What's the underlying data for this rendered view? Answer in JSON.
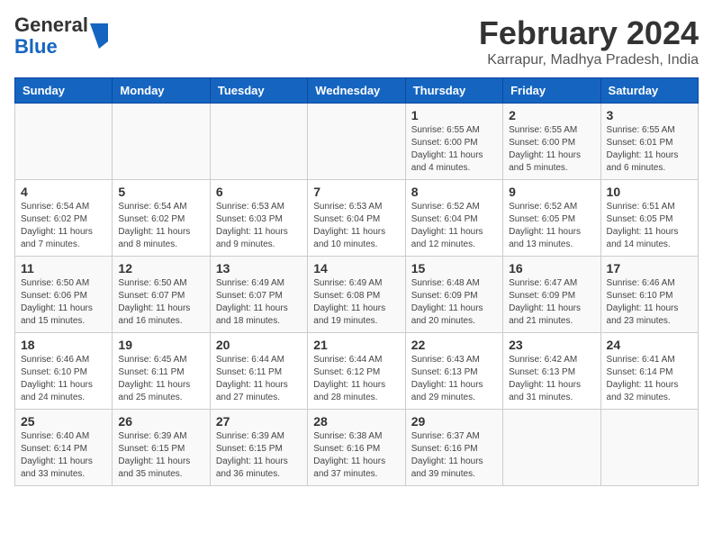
{
  "logo": {
    "general": "General",
    "blue": "Blue"
  },
  "header": {
    "month": "February 2024",
    "location": "Karrapur, Madhya Pradesh, India"
  },
  "days_of_week": [
    "Sunday",
    "Monday",
    "Tuesday",
    "Wednesday",
    "Thursday",
    "Friday",
    "Saturday"
  ],
  "weeks": [
    [
      {
        "day": "",
        "info": ""
      },
      {
        "day": "",
        "info": ""
      },
      {
        "day": "",
        "info": ""
      },
      {
        "day": "",
        "info": ""
      },
      {
        "day": "1",
        "info": "Sunrise: 6:55 AM\nSunset: 6:00 PM\nDaylight: 11 hours and 4 minutes."
      },
      {
        "day": "2",
        "info": "Sunrise: 6:55 AM\nSunset: 6:00 PM\nDaylight: 11 hours and 5 minutes."
      },
      {
        "day": "3",
        "info": "Sunrise: 6:55 AM\nSunset: 6:01 PM\nDaylight: 11 hours and 6 minutes."
      }
    ],
    [
      {
        "day": "4",
        "info": "Sunrise: 6:54 AM\nSunset: 6:02 PM\nDaylight: 11 hours and 7 minutes."
      },
      {
        "day": "5",
        "info": "Sunrise: 6:54 AM\nSunset: 6:02 PM\nDaylight: 11 hours and 8 minutes."
      },
      {
        "day": "6",
        "info": "Sunrise: 6:53 AM\nSunset: 6:03 PM\nDaylight: 11 hours and 9 minutes."
      },
      {
        "day": "7",
        "info": "Sunrise: 6:53 AM\nSunset: 6:04 PM\nDaylight: 11 hours and 10 minutes."
      },
      {
        "day": "8",
        "info": "Sunrise: 6:52 AM\nSunset: 6:04 PM\nDaylight: 11 hours and 12 minutes."
      },
      {
        "day": "9",
        "info": "Sunrise: 6:52 AM\nSunset: 6:05 PM\nDaylight: 11 hours and 13 minutes."
      },
      {
        "day": "10",
        "info": "Sunrise: 6:51 AM\nSunset: 6:05 PM\nDaylight: 11 hours and 14 minutes."
      }
    ],
    [
      {
        "day": "11",
        "info": "Sunrise: 6:50 AM\nSunset: 6:06 PM\nDaylight: 11 hours and 15 minutes."
      },
      {
        "day": "12",
        "info": "Sunrise: 6:50 AM\nSunset: 6:07 PM\nDaylight: 11 hours and 16 minutes."
      },
      {
        "day": "13",
        "info": "Sunrise: 6:49 AM\nSunset: 6:07 PM\nDaylight: 11 hours and 18 minutes."
      },
      {
        "day": "14",
        "info": "Sunrise: 6:49 AM\nSunset: 6:08 PM\nDaylight: 11 hours and 19 minutes."
      },
      {
        "day": "15",
        "info": "Sunrise: 6:48 AM\nSunset: 6:09 PM\nDaylight: 11 hours and 20 minutes."
      },
      {
        "day": "16",
        "info": "Sunrise: 6:47 AM\nSunset: 6:09 PM\nDaylight: 11 hours and 21 minutes."
      },
      {
        "day": "17",
        "info": "Sunrise: 6:46 AM\nSunset: 6:10 PM\nDaylight: 11 hours and 23 minutes."
      }
    ],
    [
      {
        "day": "18",
        "info": "Sunrise: 6:46 AM\nSunset: 6:10 PM\nDaylight: 11 hours and 24 minutes."
      },
      {
        "day": "19",
        "info": "Sunrise: 6:45 AM\nSunset: 6:11 PM\nDaylight: 11 hours and 25 minutes."
      },
      {
        "day": "20",
        "info": "Sunrise: 6:44 AM\nSunset: 6:11 PM\nDaylight: 11 hours and 27 minutes."
      },
      {
        "day": "21",
        "info": "Sunrise: 6:44 AM\nSunset: 6:12 PM\nDaylight: 11 hours and 28 minutes."
      },
      {
        "day": "22",
        "info": "Sunrise: 6:43 AM\nSunset: 6:13 PM\nDaylight: 11 hours and 29 minutes."
      },
      {
        "day": "23",
        "info": "Sunrise: 6:42 AM\nSunset: 6:13 PM\nDaylight: 11 hours and 31 minutes."
      },
      {
        "day": "24",
        "info": "Sunrise: 6:41 AM\nSunset: 6:14 PM\nDaylight: 11 hours and 32 minutes."
      }
    ],
    [
      {
        "day": "25",
        "info": "Sunrise: 6:40 AM\nSunset: 6:14 PM\nDaylight: 11 hours and 33 minutes."
      },
      {
        "day": "26",
        "info": "Sunrise: 6:39 AM\nSunset: 6:15 PM\nDaylight: 11 hours and 35 minutes."
      },
      {
        "day": "27",
        "info": "Sunrise: 6:39 AM\nSunset: 6:15 PM\nDaylight: 11 hours and 36 minutes."
      },
      {
        "day": "28",
        "info": "Sunrise: 6:38 AM\nSunset: 6:16 PM\nDaylight: 11 hours and 37 minutes."
      },
      {
        "day": "29",
        "info": "Sunrise: 6:37 AM\nSunset: 6:16 PM\nDaylight: 11 hours and 39 minutes."
      },
      {
        "day": "",
        "info": ""
      },
      {
        "day": "",
        "info": ""
      }
    ]
  ]
}
